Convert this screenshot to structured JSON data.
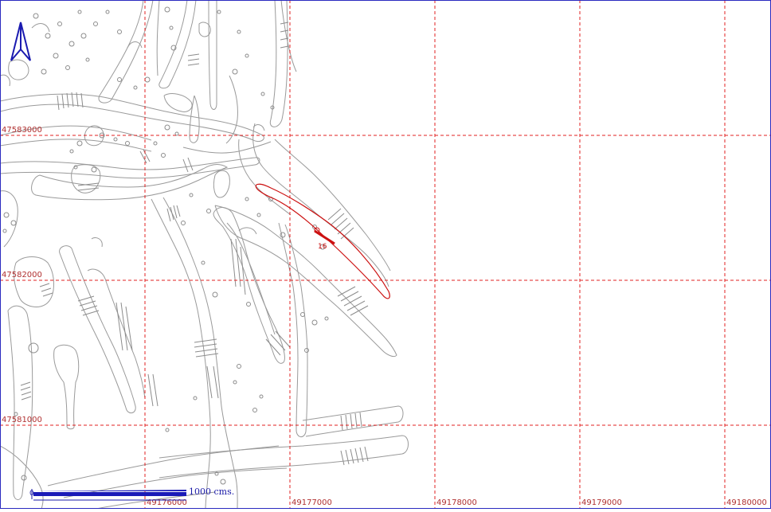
{
  "map": {
    "grid_x_labels": [
      "49176000",
      "49177000",
      "49178000",
      "49179000",
      "49180000"
    ],
    "grid_y_labels": [
      "47583000",
      "47582000",
      "47581000"
    ],
    "highlight_label": "16",
    "scale_label": "1000  cms.",
    "scale_start_label": "0",
    "grid_color": "#e02020",
    "highlight_color": "#cc1111",
    "feature_color": "#9a9a9a",
    "north_arrow_color": "#1a1ab0",
    "icons": [
      "north-arrow-icon"
    ]
  }
}
